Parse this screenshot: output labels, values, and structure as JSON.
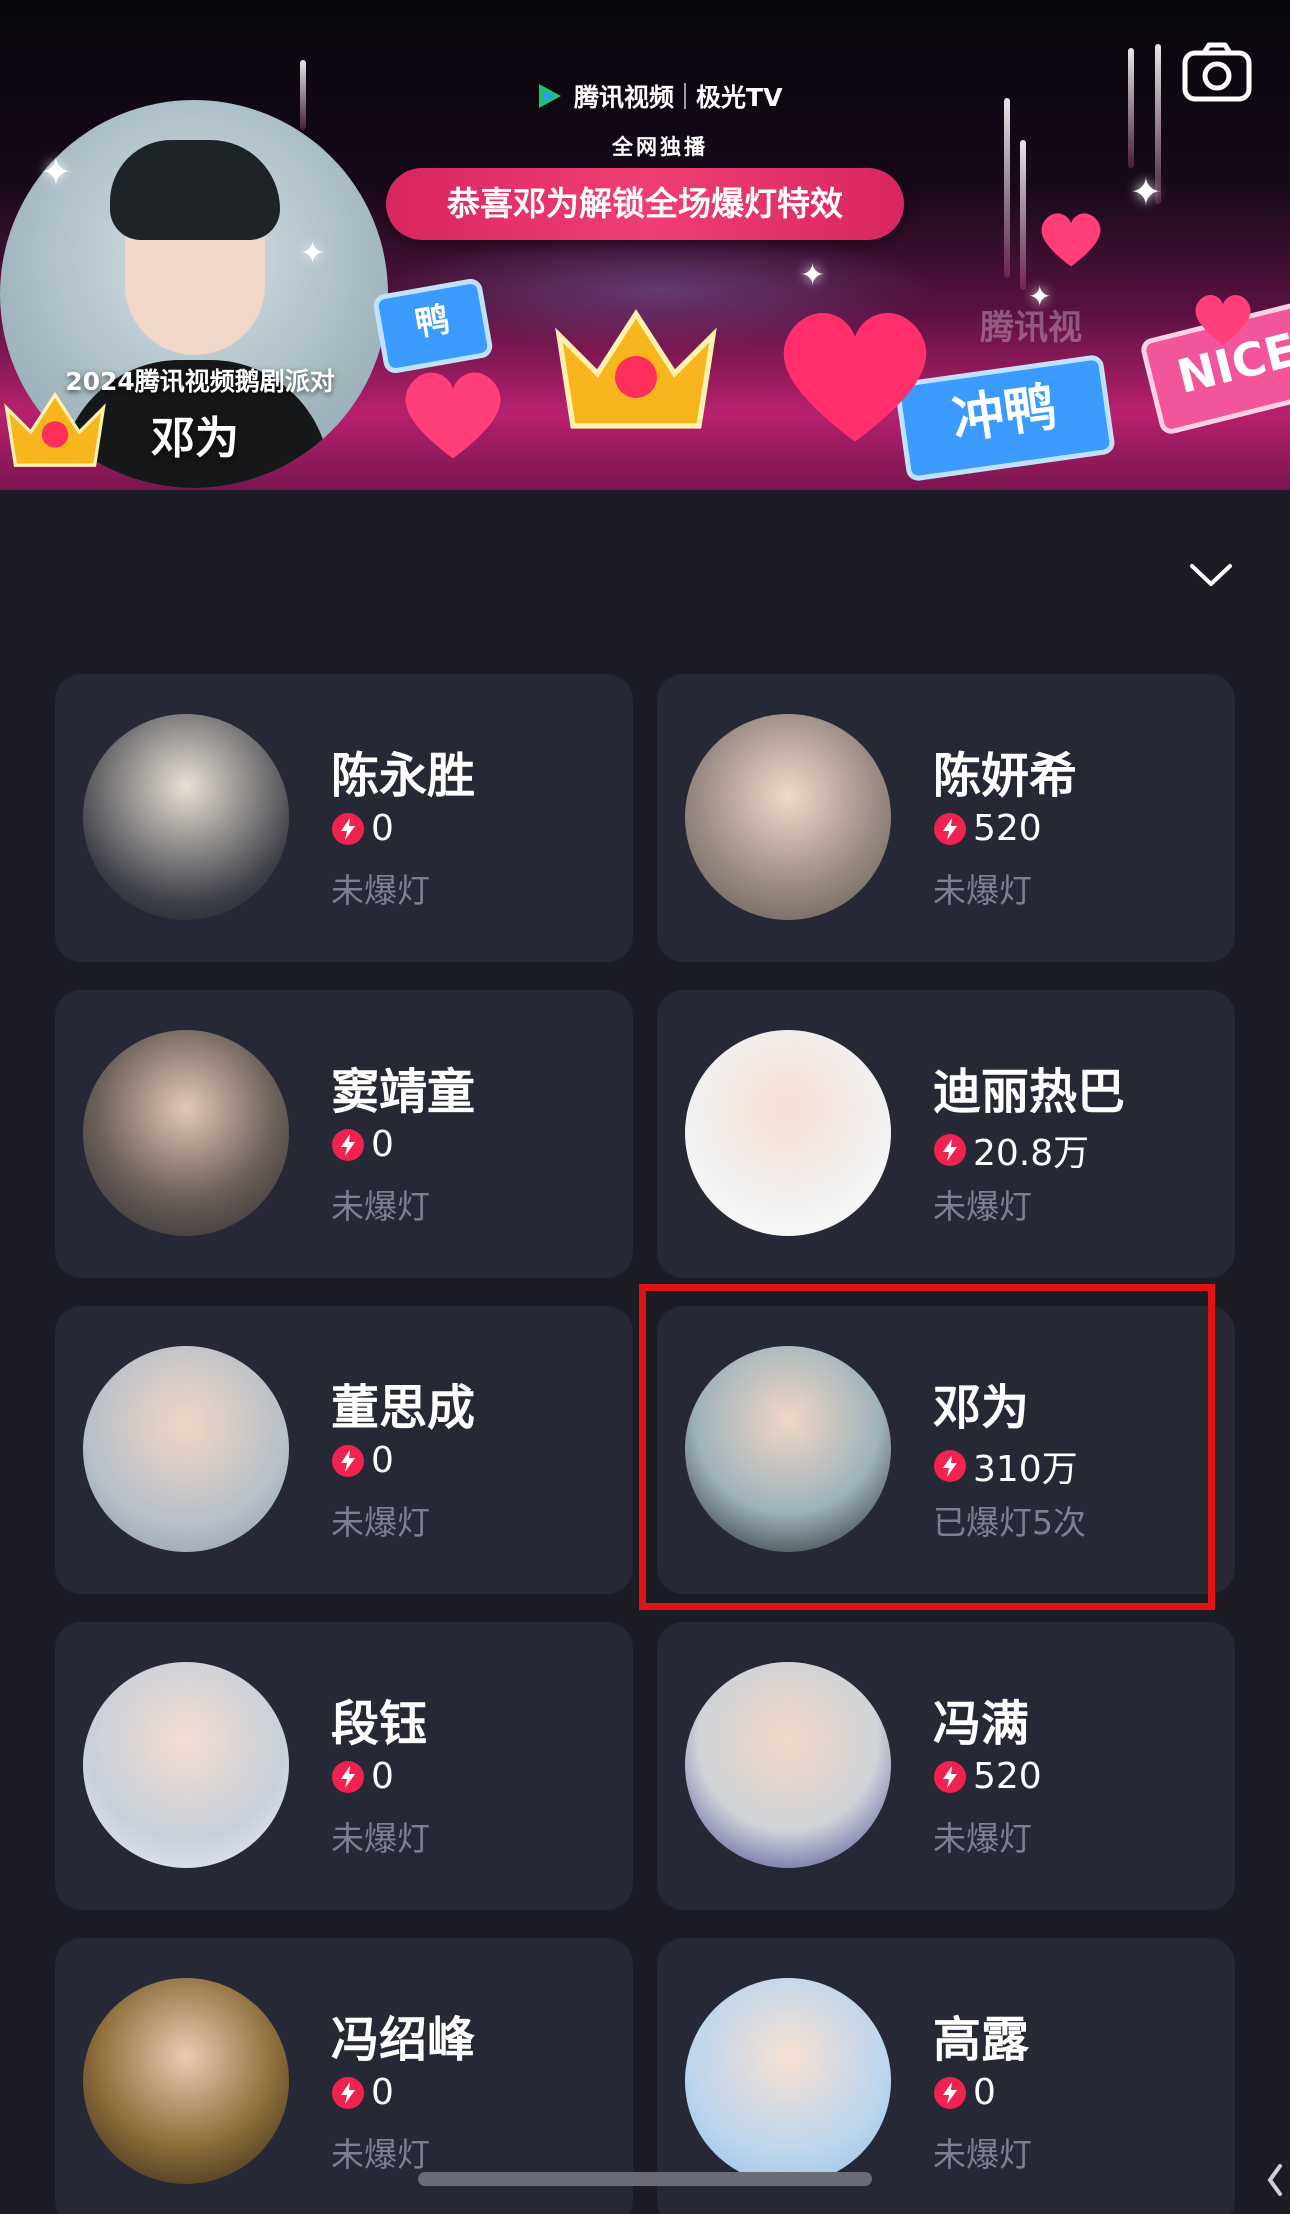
{
  "banner": {
    "brand_name": "腾讯视频",
    "brand_partner": "极光TV",
    "exclusive_label": "全网独播",
    "notice": "恭喜邓为解锁全场爆灯特效",
    "party_title": "2024腾讯视频鹅剧派对",
    "featured_name": "邓为",
    "sign_left": "鸭",
    "sign_main": "冲鸭",
    "sign_right": "NICE",
    "watermark": "腾讯视"
  },
  "icons": {
    "camera": "camera-icon",
    "collapse": "chevron-down-icon",
    "bolt": "lightning-icon"
  },
  "colors": {
    "background": "#1b1c26",
    "card": "#262836",
    "notice_pink": "#e8366d",
    "bolt_red": "#f0224f",
    "status_gray": "#7e8092",
    "highlight_red": "#e01313"
  },
  "cards": [
    {
      "name": "陈永胜",
      "score": "0",
      "status": "未爆灯"
    },
    {
      "name": "陈妍希",
      "score": "520",
      "status": "未爆灯"
    },
    {
      "name": "窦靖童",
      "score": "0",
      "status": "未爆灯"
    },
    {
      "name": "迪丽热巴",
      "score": "20.8万",
      "status": "未爆灯"
    },
    {
      "name": "董思成",
      "score": "0",
      "status": "未爆灯"
    },
    {
      "name": "邓为",
      "score": "310万",
      "status": "已爆灯5次"
    },
    {
      "name": "段钰",
      "score": "0",
      "status": "未爆灯"
    },
    {
      "name": "冯满",
      "score": "520",
      "status": "未爆灯"
    },
    {
      "name": "冯绍峰",
      "score": "0",
      "status": "未爆灯"
    },
    {
      "name": "高露",
      "score": "0",
      "status": "未爆灯"
    }
  ]
}
